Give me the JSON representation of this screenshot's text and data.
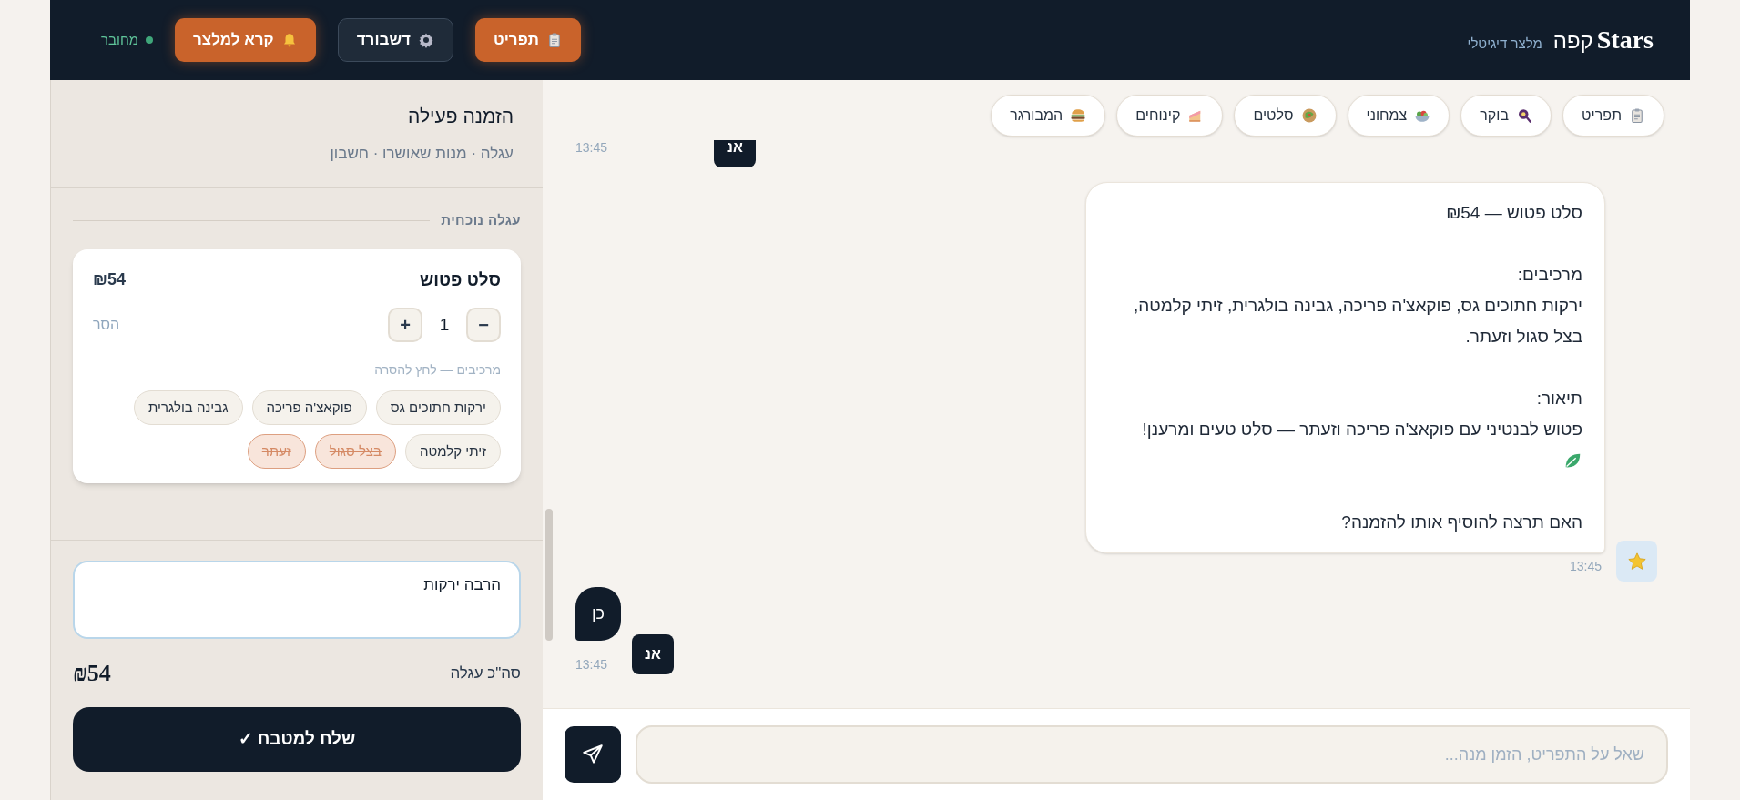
{
  "header": {
    "brand": "Stars",
    "brand_suffix": "קפה",
    "subtitle": "מלצר דיגיטלי",
    "buttons": [
      {
        "label": "תפריט",
        "kind": "menu"
      },
      {
        "label": "דשבורד",
        "kind": "dashboard"
      },
      {
        "label": "קרא למלצר",
        "kind": "call"
      }
    ],
    "status": {
      "label": "מחובר",
      "color": "#3fa67a"
    }
  },
  "order_panel": {
    "title": "הזמנה פעילה",
    "subtitle": "עגלה · מנות שאושרו · חשבון",
    "section": "עגלה נוכחית",
    "cart_items": [
      {
        "name": "סלט פטוש",
        "price": "₪54",
        "quantity": "1",
        "minus": "−",
        "plus": "+",
        "remove": "הסר",
        "ingredients_hint": "מרכיבים — לחץ להסרה",
        "ingredients": [
          {
            "label": "ירקות חתוכים גס",
            "removed": false
          },
          {
            "label": "פוקאצ'ה פריכה",
            "removed": false
          },
          {
            "label": "גבינה בולגרית",
            "removed": false
          },
          {
            "label": "זיתי קלמטה",
            "removed": false
          },
          {
            "label": "בצל סגול",
            "removed": true
          },
          {
            "label": "זעתר",
            "removed": true
          }
        ]
      }
    ],
    "notes": {
      "value": "הרבה ירקות"
    },
    "total_label": "סה\"כ עגלה",
    "total": "₪54",
    "send_button": "שלח למטבח ✓"
  },
  "chat": {
    "quick_chips": [
      {
        "label": "תפריט",
        "kind": "clipboard"
      },
      {
        "label": "בוקר",
        "kind": "egg"
      },
      {
        "label": "צמחוני",
        "kind": "salad"
      },
      {
        "label": "סלטים",
        "kind": "wrap"
      },
      {
        "label": "קינוחים",
        "kind": "cake"
      },
      {
        "label": "המבורגר",
        "kind": "burger"
      }
    ],
    "messages": [
      {
        "kind": "user",
        "avatar": "אנ",
        "time": "13:45"
      },
      {
        "kind": "bot",
        "time": "13:45",
        "parts": [
          {
            "kind": "text",
            "text": "סלט פטוש — ₪54"
          },
          {
            "kind": "gap"
          },
          {
            "kind": "text",
            "text": "מרכיבים:"
          },
          {
            "kind": "text",
            "text": "ירקות חתוכים גס, פוקאצ'ה פריכה, גבינה בולגרית, זיתי קלמטה, בצל סגול וזעתר."
          },
          {
            "kind": "gap"
          },
          {
            "kind": "text",
            "text": "תיאור:"
          },
          {
            "kind": "text",
            "text": "פטוש לבנטיני עם פוקאצ'ה פריכה וזעתר — סלט טעים ומרענן!"
          },
          {
            "kind": "leaf"
          },
          {
            "kind": "gap"
          },
          {
            "kind": "text",
            "text": "האם תרצה להוסיף אותו להזמנה?"
          }
        ]
      },
      {
        "kind": "user",
        "avatar": "אנ",
        "text": "כן",
        "time": "13:45"
      }
    ],
    "input": {
      "placeholder": "שאל על התפריט, הזמן מנה..."
    }
  }
}
